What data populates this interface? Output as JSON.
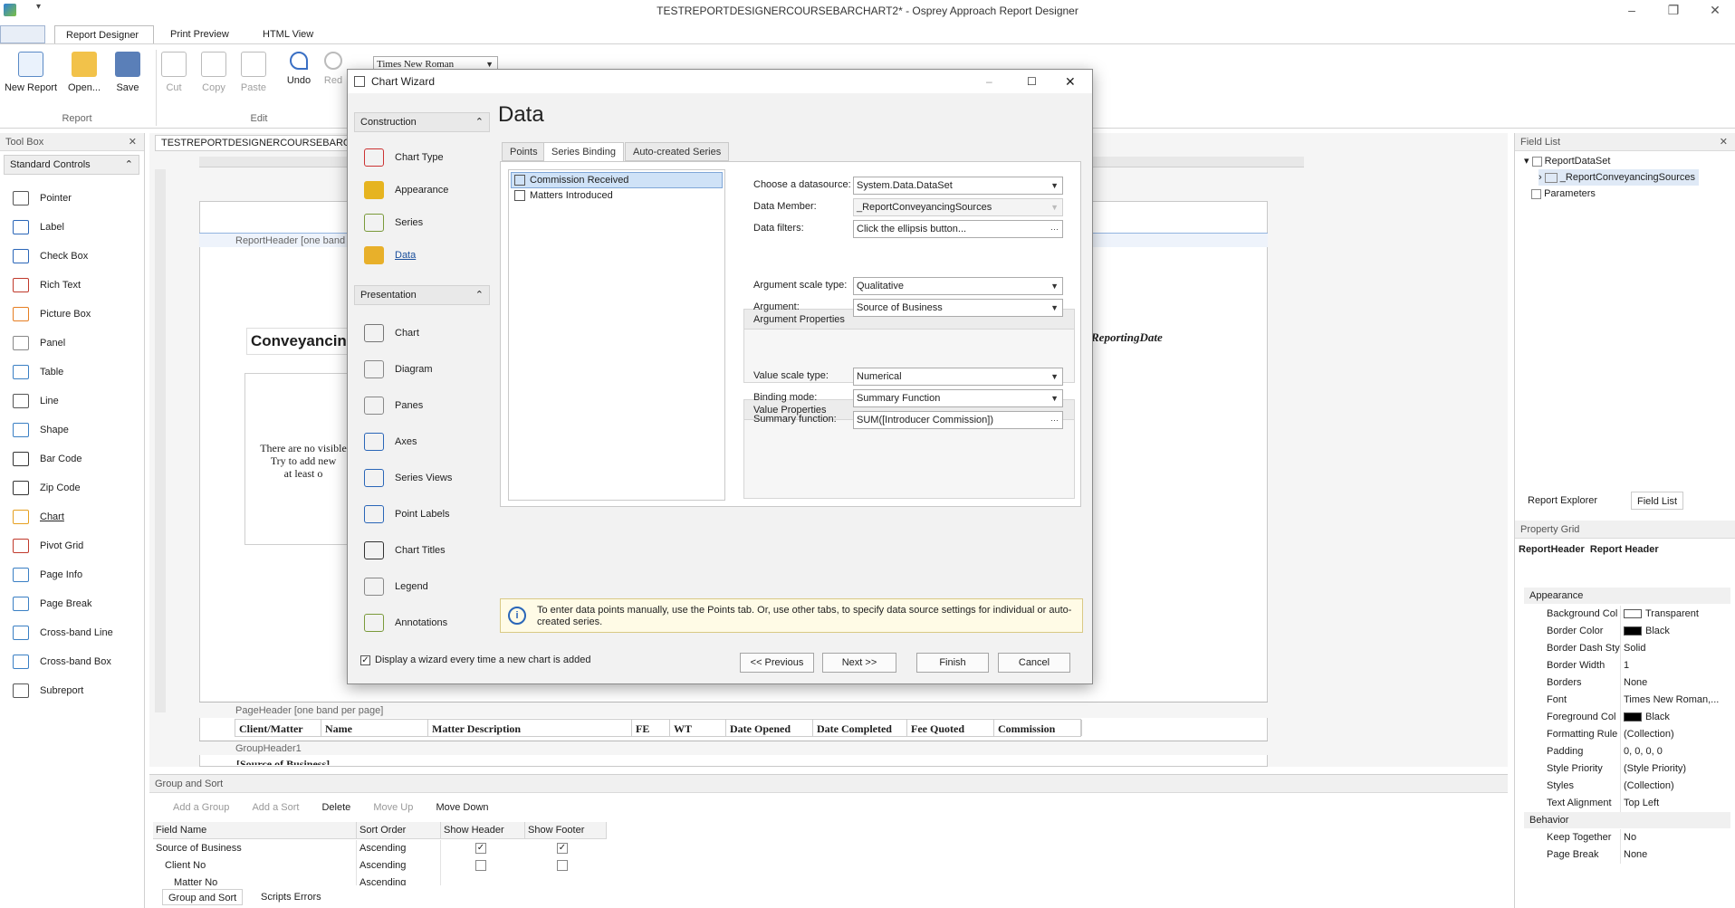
{
  "window": {
    "title": "TESTREPORTDESIGNERCOURSEBARCHART2* - Osprey Approach Report Designer"
  },
  "tabs": [
    "Report Designer",
    "Print Preview",
    "HTML View"
  ],
  "ribbon": {
    "report_group": "Report",
    "edit_group": "Edit",
    "new_report": "New Report",
    "open": "Open...",
    "save": "Save",
    "cut": "Cut",
    "copy": "Copy",
    "paste": "Paste",
    "undo": "Undo",
    "redo": "Red",
    "font": "Times New Roman"
  },
  "toolbox": {
    "title": "Tool Box",
    "category": "Standard Controls",
    "items": [
      "Pointer",
      "Label",
      "Check Box",
      "Rich Text",
      "Picture Box",
      "Panel",
      "Table",
      "Line",
      "Shape",
      "Bar Code",
      "Zip Code",
      "Chart",
      "Pivot Grid",
      "Page Info",
      "Page Break",
      "Cross-band Line",
      "Cross-band Box",
      "Subreport"
    ]
  },
  "designer": {
    "doc_tab": "TESTREPORTDESIGNERCOURSEBARCHART",
    "report_header_band": "ReportHeader [one band",
    "title_text": "Conveyancin",
    "placeholder_line1": "There are no visible",
    "placeholder_line2": "Try to add new",
    "placeholder_line3": "at least o",
    "reporting_date": "ReportingDate",
    "page_header_band": "PageHeader [one band per page]",
    "columns": [
      "Client/Matter",
      "Name",
      "Matter Description",
      "FE",
      "WT",
      "Date Opened",
      "Date Completed",
      "Fee Quoted",
      "Commission"
    ],
    "group_header_band": "GroupHeader1",
    "group_field": "[Source of Business]"
  },
  "wizard": {
    "title": "Chart Wizard",
    "heading": "Data",
    "construction": "Construction",
    "construction_items": [
      "Chart Type",
      "Appearance",
      "Series",
      "Data"
    ],
    "presentation": "Presentation",
    "presentation_items": [
      "Chart",
      "Diagram",
      "Panes",
      "Axes",
      "Series Views",
      "Point Labels",
      "Chart Titles",
      "Legend",
      "Annotations"
    ],
    "tabs": [
      "Points",
      "Series Binding",
      "Auto-created Series"
    ],
    "series": [
      "Commission Received",
      "Matters Introduced"
    ],
    "datasource_label": "Choose a datasource:",
    "datasource_value": "System.Data.DataSet",
    "data_member_label": "Data Member:",
    "data_member_value": "_ReportConveyancingSources",
    "data_filters_label": "Data filters:",
    "data_filters_value": "Click the ellipsis button...",
    "argument_props": "Argument Properties",
    "arg_scale_label": "Argument scale type:",
    "arg_scale_value": "Qualitative",
    "argument_label": "Argument:",
    "argument_value": "Source of Business",
    "value_props": "Value Properties",
    "value_scale_label": "Value scale type:",
    "value_scale_value": "Numerical",
    "binding_mode_label": "Binding mode:",
    "binding_mode_value": "Summary Function",
    "summary_label": "Summary function:",
    "summary_value": "SUM([Introducer Commission])",
    "info": "To enter data points manually, use the Points tab. Or, use other tabs, to specify data source settings for individual or auto-created series.",
    "checkbox_label": "Display a wizard every time a new chart is added",
    "previous": "<< Previous",
    "next": "Next >>",
    "finish": "Finish",
    "cancel": "Cancel"
  },
  "field_list": {
    "title": "Field List",
    "dataset": "ReportDataSet",
    "table": "_ReportConveyancingSources",
    "params": "Parameters",
    "tab_explorer": "Report Explorer",
    "tab_fields": "Field List"
  },
  "property_grid": {
    "title": "Property Grid",
    "selected": "ReportHeader",
    "selected_type": "Report Header",
    "appearance": "Appearance",
    "behavior": "Behavior",
    "rows": [
      {
        "name": "Background Col",
        "value": "Transparent"
      },
      {
        "name": "Border Color",
        "value": "Black"
      },
      {
        "name": "Border Dash Sty",
        "value": "Solid"
      },
      {
        "name": "Border Width",
        "value": "1"
      },
      {
        "name": "Borders",
        "value": "None"
      },
      {
        "name": "Font",
        "value": "Times New Roman,..."
      },
      {
        "name": "Foreground Col",
        "value": "Black"
      },
      {
        "name": "Formatting Rule",
        "value": "(Collection)"
      },
      {
        "name": "Padding",
        "value": "0, 0, 0, 0"
      },
      {
        "name": "Style Priority",
        "value": "(Style Priority)"
      },
      {
        "name": "Styles",
        "value": "(Collection)"
      },
      {
        "name": "Text Alignment",
        "value": "Top Left"
      }
    ],
    "behavior_rows": [
      {
        "name": "Keep Together",
        "value": "No"
      },
      {
        "name": "Page Break",
        "value": "None"
      }
    ]
  },
  "group_sort": {
    "title": "Group and Sort",
    "add_group": "Add a Group",
    "add_sort": "Add a Sort",
    "delete": "Delete",
    "move_up": "Move Up",
    "move_down": "Move Down",
    "headers": [
      "Field Name",
      "Sort Order",
      "Show Header",
      "Show Footer"
    ],
    "rows": [
      {
        "field": "Source of Business",
        "order": "Ascending"
      },
      {
        "field": "Client No",
        "order": "Ascending"
      },
      {
        "field": "Matter No",
        "order": "Ascending"
      }
    ],
    "tab1": "Group and Sort",
    "tab2": "Scripts Errors"
  }
}
